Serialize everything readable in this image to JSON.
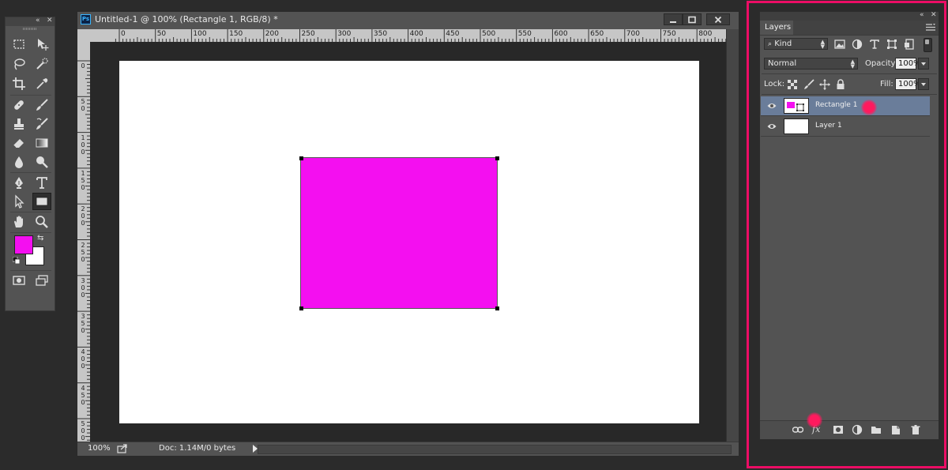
{
  "tools_panel": {
    "collapse_icon": "double-chevron-left-icon",
    "close_icon": "close-icon",
    "tools": [
      {
        "name": "rectangular-marquee-icon"
      },
      {
        "name": "move-tool-icon"
      },
      {
        "name": "lasso-icon"
      },
      {
        "name": "quick-selection-icon"
      },
      {
        "name": "crop-icon"
      },
      {
        "name": "eyedropper-icon"
      },
      {
        "name": "healing-brush-icon"
      },
      {
        "name": "brush-icon"
      },
      {
        "name": "clone-stamp-icon"
      },
      {
        "name": "history-brush-icon"
      },
      {
        "name": "eraser-icon"
      },
      {
        "name": "gradient-icon"
      },
      {
        "name": "blur-icon"
      },
      {
        "name": "dodge-icon"
      },
      {
        "name": "pen-icon"
      },
      {
        "name": "type-tool-icon"
      },
      {
        "name": "path-selection-icon"
      },
      {
        "name": "rectangle-tool-icon",
        "active": true
      },
      {
        "name": "hand-tool-icon"
      },
      {
        "name": "zoom-tool-icon"
      },
      {
        "name": "quick-mask-icon"
      },
      {
        "name": "screen-mode-icon"
      }
    ],
    "foreground_color": "#f40ff0",
    "background_color": "#ffffff"
  },
  "document": {
    "app_badge": "Ps",
    "title": "Untitled-1 @ 100% (Rectangle 1, RGB/8) *",
    "ruler_h_labels": [
      "0",
      "50",
      "100",
      "150",
      "200",
      "250",
      "300",
      "350",
      "400",
      "450",
      "500",
      "550",
      "600",
      "650",
      "700",
      "750",
      "800"
    ],
    "ruler_v_labels": [
      "0",
      "5\n0",
      "1\n0\n0",
      "1\n5\n0",
      "2\n0\n0",
      "2\n5\n0",
      "3\n0\n0",
      "3\n5\n0",
      "4\n0\n0",
      "4\n5\n0",
      "5\n0\n0"
    ],
    "canvas_color": "#ffffff",
    "shape_fill": "#f40ff0",
    "status": {
      "zoom": "100%",
      "doc_info": "Doc: 1.14M/0 bytes"
    }
  },
  "layers_panel": {
    "tab_label": "Layers",
    "filter_kind": "Kind",
    "blend_mode": "Normal",
    "opacity_label": "Opacity:",
    "opacity_value": "100%",
    "lock_label": "Lock:",
    "fill_label": "Fill:",
    "fill_value": "100%",
    "layers": [
      {
        "name": "Rectangle 1",
        "selected": true,
        "visible": true
      },
      {
        "name": "Layer 1",
        "selected": false,
        "visible": true
      }
    ],
    "bottom_icons": [
      "link-layers-icon",
      "fx-icon",
      "layer-mask-icon",
      "adjustment-layer-icon",
      "new-group-icon",
      "new-layer-icon",
      "delete-icon"
    ],
    "fx_label": "fx"
  },
  "colors": {
    "highlight": "#ec0d65",
    "selected_layer": "#6a7d9a"
  }
}
